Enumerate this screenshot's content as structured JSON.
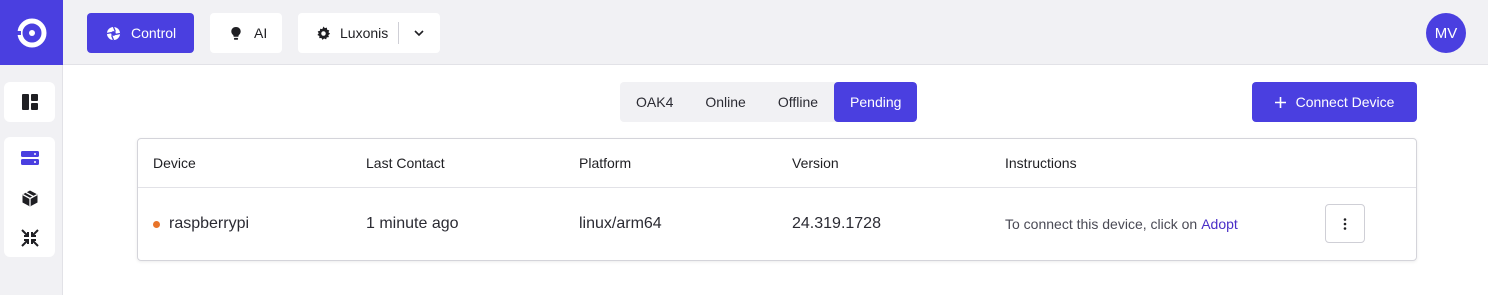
{
  "brand": {
    "accent": "#4a3fe0",
    "logo_icon": "luxonis-ring-logo"
  },
  "topbar": {
    "control_label": "Control",
    "control_icon": "aperture-icon",
    "ai_label": "AI",
    "ai_icon": "lightbulb-icon",
    "org_label": "Luxonis",
    "org_icon": "gear-icon",
    "avatar_initials": "MV"
  },
  "sidebar": {
    "items": [
      {
        "name": "dashboard",
        "icon": "dashboard-icon"
      },
      {
        "name": "devices",
        "icon": "server-stack-icon",
        "active": true
      },
      {
        "name": "packages",
        "icon": "package-icon"
      },
      {
        "name": "collapse",
        "icon": "arrows-in-icon"
      }
    ]
  },
  "filters": {
    "tabs": [
      "OAK4",
      "Online",
      "Offline",
      "Pending"
    ],
    "active": "Pending"
  },
  "connect_button": {
    "label": "Connect Device",
    "icon": "plus-icon"
  },
  "table": {
    "headers": [
      "Device",
      "Last Contact",
      "Platform",
      "Version",
      "Instructions"
    ],
    "rows": [
      {
        "device": "raspberrypi",
        "status_color": "#e8742a",
        "last_contact": "1 minute ago",
        "platform": "linux/arm64",
        "version": "24.319.1728",
        "instructions_text": "To connect this device, click on",
        "instructions_link": "Adopt"
      }
    ]
  }
}
